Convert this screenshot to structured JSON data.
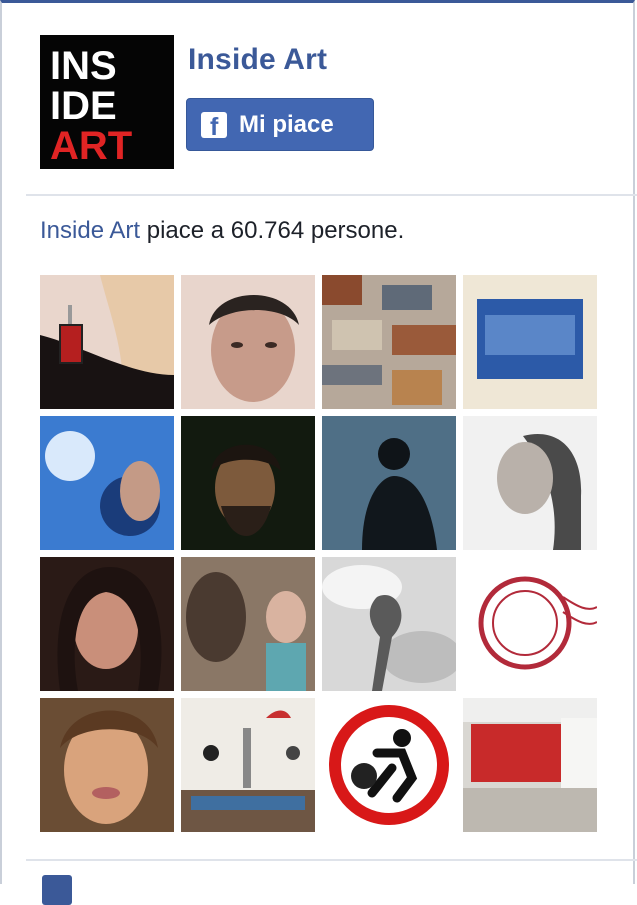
{
  "page": {
    "name": "Inside Art",
    "logo_lines": [
      "INS",
      "IDE",
      "ART"
    ],
    "like_button_label": "Mi piace",
    "like_icon_glyph": "f"
  },
  "summary": {
    "page_link": "Inside Art",
    "text": " piace a 60.764 persone."
  },
  "colors": {
    "brand_blue": "#3b5998",
    "button_blue": "#4267b2",
    "separator": "#dfe3ea"
  },
  "fans": [
    {
      "name": "fan-photo-1"
    },
    {
      "name": "fan-photo-2"
    },
    {
      "name": "fan-photo-3"
    },
    {
      "name": "fan-photo-4"
    },
    {
      "name": "fan-photo-5"
    },
    {
      "name": "fan-photo-6"
    },
    {
      "name": "fan-photo-7"
    },
    {
      "name": "fan-photo-8"
    },
    {
      "name": "fan-photo-9"
    },
    {
      "name": "fan-photo-10"
    },
    {
      "name": "fan-photo-11"
    },
    {
      "name": "fan-photo-12"
    },
    {
      "name": "fan-photo-13"
    },
    {
      "name": "fan-photo-14"
    },
    {
      "name": "fan-photo-15"
    },
    {
      "name": "fan-photo-16"
    }
  ],
  "icons": {
    "page_logo": "inside-art-logo",
    "like": "facebook-f-icon",
    "footer": "facebook-icon"
  }
}
